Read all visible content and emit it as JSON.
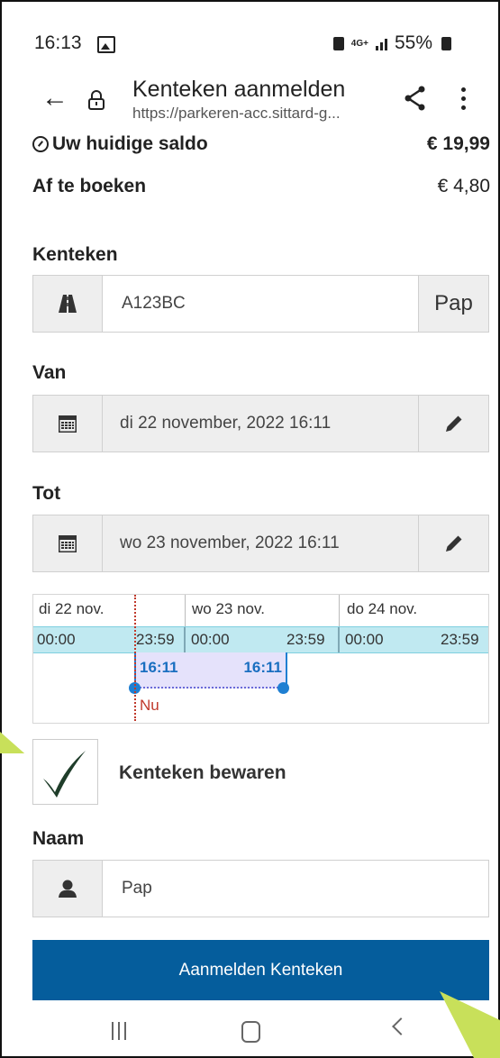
{
  "status_bar": {
    "time": "16:13",
    "network": "4G+",
    "battery": "55%"
  },
  "app_bar": {
    "title": "Kenteken aanmelden",
    "url": "https://parkeren-acc.sittard-g..."
  },
  "balance": {
    "label": "Uw huidige saldo",
    "value": "€ 19,99"
  },
  "booking": {
    "label": "Af te boeken",
    "value": "€ 4,80"
  },
  "kenteken": {
    "label": "Kenteken",
    "value": "A123BC",
    "addon_right": "Pap",
    "icon": "road-icon"
  },
  "van": {
    "label": "Van",
    "value": "di 22 november, 2022 16:11",
    "icon": "calendar-icon",
    "edit_icon": "pencil-icon"
  },
  "tot": {
    "label": "Tot",
    "value": "wo 23 november, 2022 16:11",
    "icon": "calendar-icon",
    "edit_icon": "pencil-icon"
  },
  "timeline": {
    "days": [
      "di 22 nov.",
      "wo 23 nov.",
      "do 24 nov."
    ],
    "start_time": "00:00",
    "end_time": "23:59",
    "selection_start": "16:11",
    "selection_end": "16:11",
    "now_label": "Nu"
  },
  "save_plate": {
    "label": "Kenteken bewaren",
    "checked": true
  },
  "naam": {
    "label": "Naam",
    "value": "Pap",
    "icon": "user-icon"
  },
  "submit": {
    "label": "Aanmelden Kenteken"
  },
  "colors": {
    "primary": "#055d9c",
    "band": "#c0e9f1",
    "selection": "#e5e2fb",
    "now": "#c0392b",
    "annotation": "#c8e05a"
  }
}
